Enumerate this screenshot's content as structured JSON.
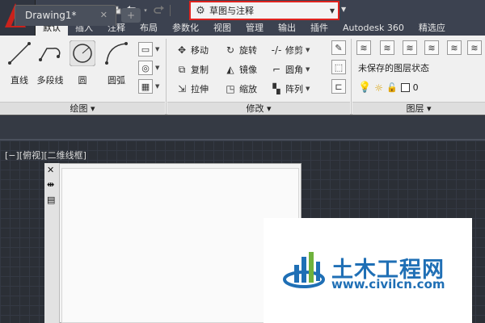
{
  "quick_access": {
    "workspace": "草图与注释"
  },
  "ribbon_tabs": [
    "默认",
    "插入",
    "注释",
    "布局",
    "参数化",
    "视图",
    "管理",
    "输出",
    "插件",
    "Autodesk 360",
    "精选应"
  ],
  "draw": {
    "line": "直线",
    "polyline": "多段线",
    "circle": "圆",
    "arc": "圆弧",
    "panel_title": "绘图 ▾"
  },
  "modify": {
    "move": "移动",
    "rotate": "旋转",
    "trim": "修剪",
    "copy": "复制",
    "mirror": "镜像",
    "fillet": "圆角",
    "stretch": "拉伸",
    "scale": "缩放",
    "array": "阵列",
    "panel_title": "修改 ▾"
  },
  "layers": {
    "state": "未保存的图层状态",
    "current_layer": "0",
    "panel_title": "图层 ▾"
  },
  "file_tab": {
    "name": "Drawing1*"
  },
  "viewport": {
    "label": "[−][俯视][二维线框]"
  },
  "watermark": {
    "name": "土木工程网",
    "url": "www.civilcn.com"
  },
  "colors": {
    "accent": "#e0231e",
    "brand_red": "#c9221c",
    "watermark_blue": "#1f6fb5"
  }
}
